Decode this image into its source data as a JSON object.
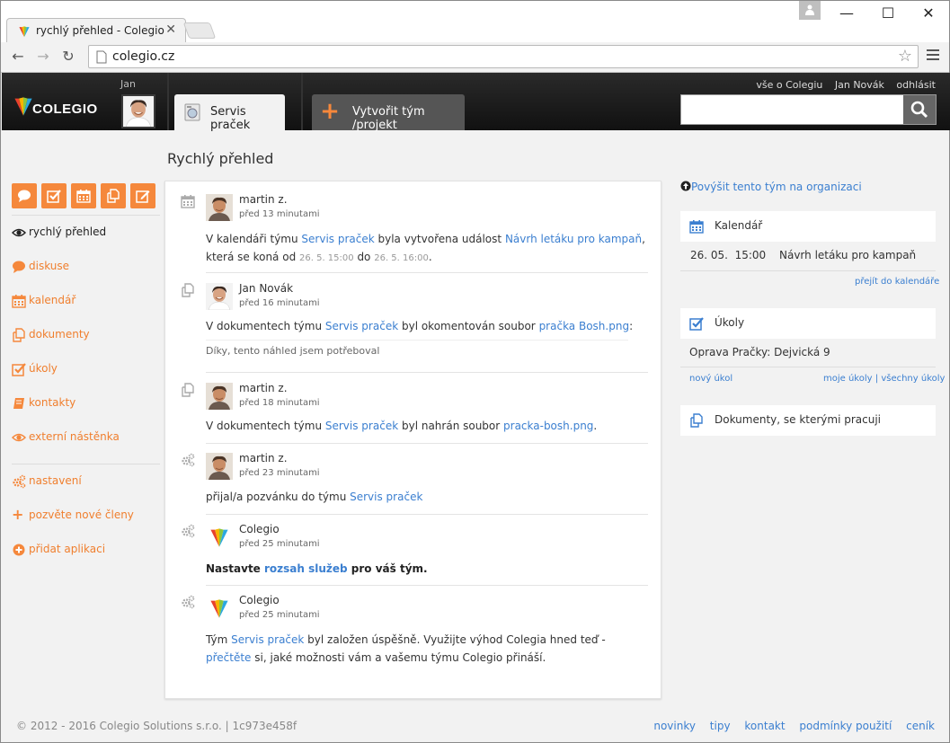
{
  "browser": {
    "tab_title": "rychlý přehled - Colegio",
    "url": "colegio.cz"
  },
  "header": {
    "logo_text": "COLEGIO",
    "user_short": "Jan",
    "team_tab": "Servis praček",
    "create_tab": "Vytvořit tým /projekt",
    "links": {
      "about": "vše o Colegiu",
      "user": "Jan Novák",
      "logout": "odhlásit"
    },
    "search_placeholder": ""
  },
  "sidebar": {
    "items": [
      {
        "label": "rychlý přehled",
        "icon": "eye-icon"
      },
      {
        "label": "diskuse",
        "icon": "chat-icon"
      },
      {
        "label": "kalendář",
        "icon": "calendar-icon"
      },
      {
        "label": "dokumenty",
        "icon": "documents-icon"
      },
      {
        "label": "úkoly",
        "icon": "task-icon"
      },
      {
        "label": "kontakty",
        "icon": "contacts-icon"
      },
      {
        "label": "externí nástěnka",
        "icon": "eye-icon"
      }
    ],
    "settings": [
      {
        "label": "nastavení",
        "icon": "gears-icon"
      },
      {
        "label": "pozvěte nové členy",
        "icon": "plus-icon"
      },
      {
        "label": "přidat aplikaci",
        "icon": "plus-circle-icon"
      }
    ]
  },
  "main": {
    "title": "Rychlý přehled",
    "feed": [
      {
        "who": "martin z.",
        "when": "před 13 minutami",
        "t1": "V kalendáři týmu ",
        "team": "Servis praček",
        "t2": " byla vytvořena událost ",
        "event": "Návrh letáku pro kampaň",
        "t3": ",",
        "t4": "která se koná od ",
        "from": "26. 5. 15:00",
        "t5": " do ",
        "to": "26. 5. 16:00",
        "t6": "."
      },
      {
        "who": "Jan Novák",
        "when": "před 16 minutami",
        "t1": "V dokumentech týmu ",
        "team": "Servis praček",
        "t2": " byl okomentován soubor ",
        "file": "pračka Bosh.png",
        "t3": ":",
        "comment": "Díky, tento náhled jsem potřeboval"
      },
      {
        "who": "martin z.",
        "when": "před 18 minutami",
        "t1": "V dokumentech týmu ",
        "team": "Servis praček",
        "t2": " byl nahrán soubor ",
        "file": "pracka-bosh.png",
        "t3": "."
      },
      {
        "who": "martin z.",
        "when": "před 23 minutami",
        "t1": "přijal/a pozvánku do týmu ",
        "team": "Servis praček"
      },
      {
        "who": "Colegio",
        "when": "před 25 minutami",
        "t1": "Nastavte ",
        "link": "rozsah služeb",
        "t2": " pro váš tým."
      },
      {
        "who": "Colegio",
        "when": "před 25 minutami",
        "t1": "Tým ",
        "team": "Servis praček",
        "t2": " byl založen úspěšně. Využijte výhod Colegia hned teď -",
        "link": "přečtěte",
        "t3": " si, jaké možnosti vám a vašemu týmu Colegio přináší."
      }
    ]
  },
  "right": {
    "promote": "Povýšit tento tým na organizaci",
    "calendar": {
      "title": "Kalendář",
      "event_when": "26. 05.  15:00",
      "event_what": "Návrh letáku pro kampaň",
      "goto": "přejít do kalendáře"
    },
    "tasks": {
      "title": "Úkoly",
      "item": "Oprava Pračky: Dejvická 9",
      "new": "nový úkol",
      "mine": "moje úkoly",
      "sep": "|",
      "all": "všechny úkoly"
    },
    "documents": {
      "title": "Dokumenty, se kterými pracuji"
    }
  },
  "footer": {
    "copyright": "© 2012 - 2016 Colegio Solutions s.r.o. | 1c973e458f",
    "links": [
      "novinky",
      "tipy",
      "kontakt",
      "podmínky použití",
      "ceník"
    ]
  },
  "colors": {
    "accent": "#f5883c",
    "link": "#3b7fd0",
    "header_bg": "#1b1b1b"
  }
}
